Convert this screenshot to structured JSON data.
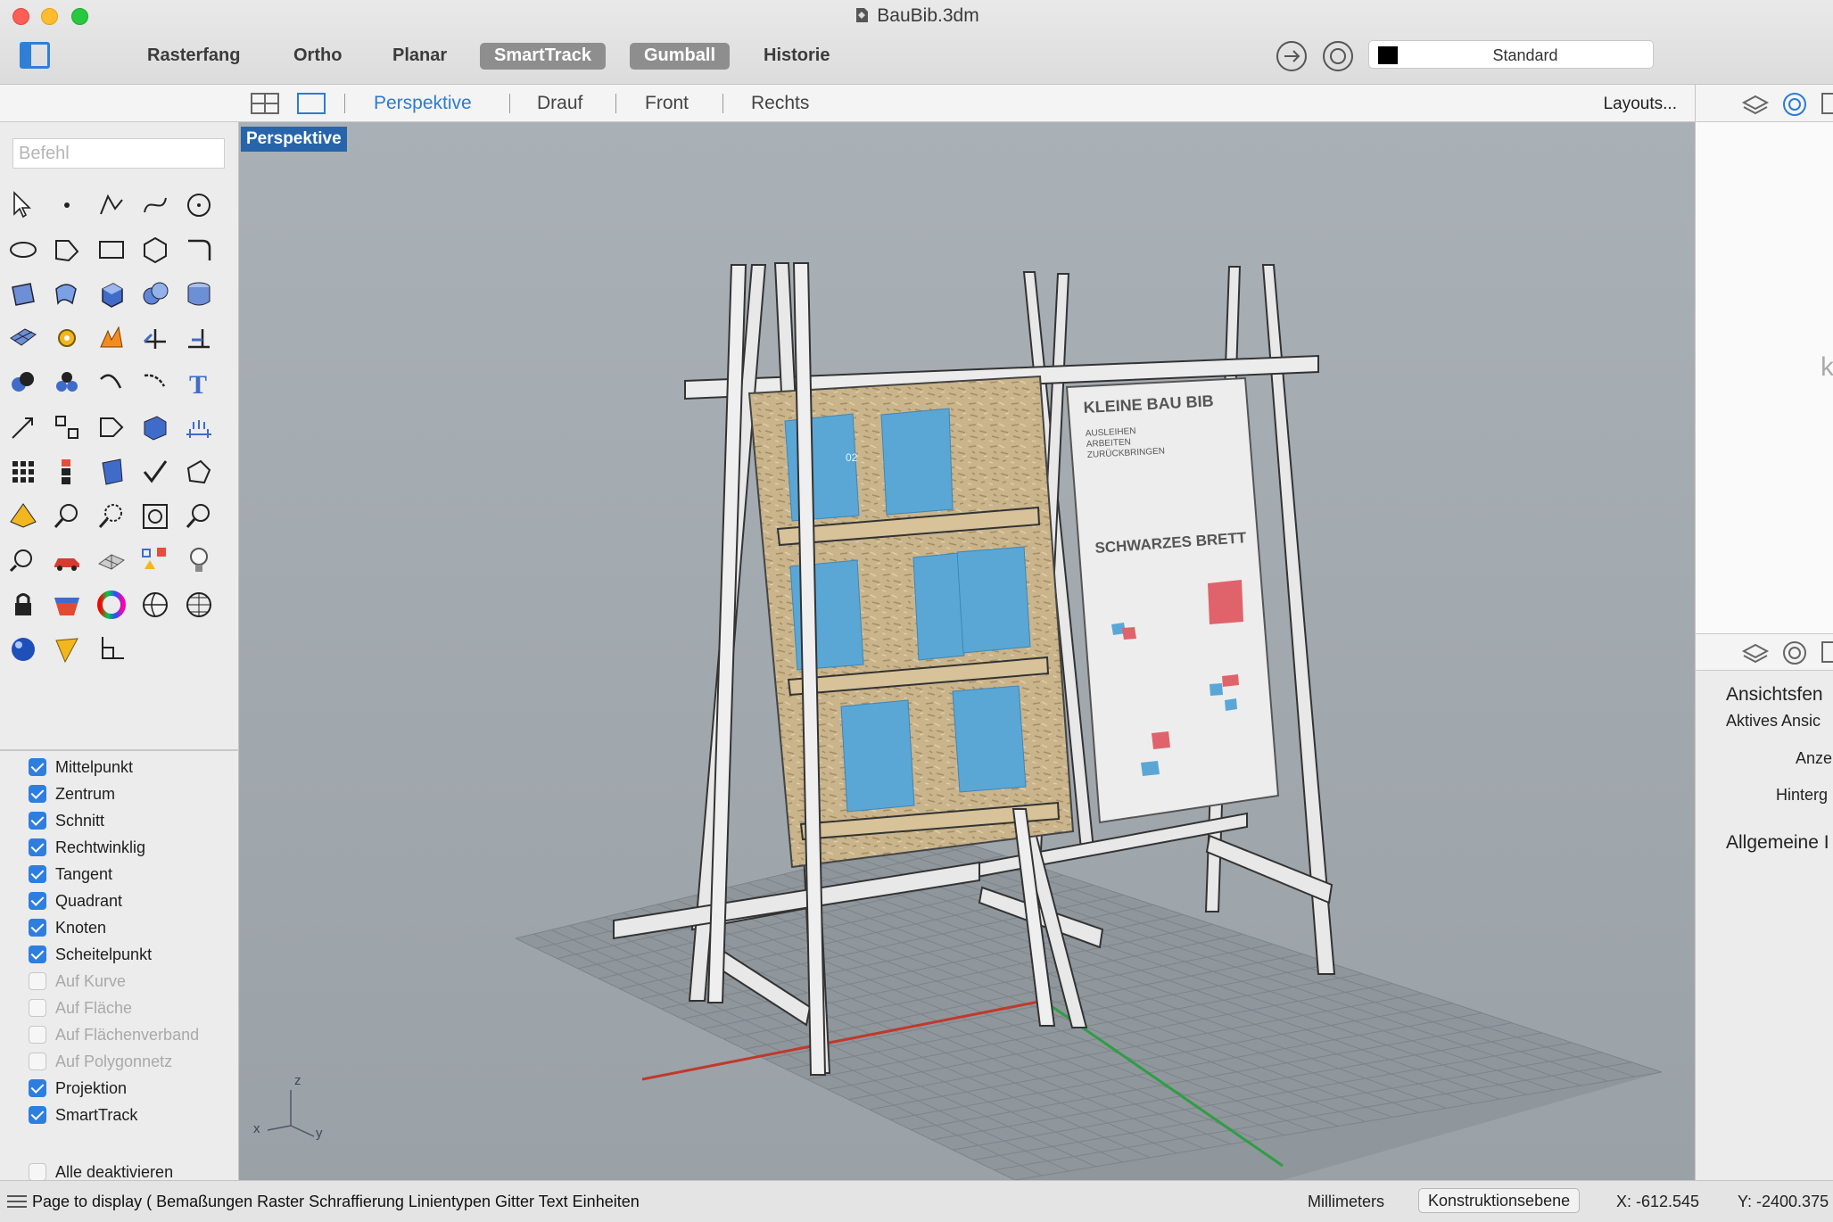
{
  "window": {
    "title": "BauBib.3dm"
  },
  "toolbar": {
    "osnap_buttons": [
      {
        "label": "Rasterfang",
        "active": false
      },
      {
        "label": "Ortho",
        "active": false
      },
      {
        "label": "Planar",
        "active": false
      },
      {
        "label": "SmartTrack",
        "active": true
      },
      {
        "label": "Gumball",
        "active": true
      },
      {
        "label": "Historie",
        "active": false
      }
    ],
    "layer": {
      "name": "Standard",
      "swatch_color": "#000000"
    }
  },
  "viewport_tabs": {
    "tabs": [
      "Perspektive",
      "Drauf",
      "Front",
      "Rechts"
    ],
    "active": "Perspektive",
    "layouts_label": "Layouts..."
  },
  "command": {
    "placeholder": "Befehl"
  },
  "tool_icons": [
    "select-arrow-icon",
    "point-icon",
    "polyline-icon",
    "curve-icon",
    "circle-icon",
    "ellipse-icon",
    "arc-icon",
    "rectangle-icon",
    "polygon-icon",
    "fillet-curve-icon",
    "surface-icon",
    "sweep-surface-icon",
    "box-solid-icon",
    "sphere-union-icon",
    "cylinder-icon",
    "mesh-plane-icon",
    "gear-icon",
    "explode-icon",
    "trim-icon",
    "split-icon",
    "boolean-icon",
    "group-icon",
    "curve-edit-icon",
    "fillet-edges-icon",
    "text-icon",
    "move-icon",
    "array-icon",
    "flow-icon",
    "extrude-icon",
    "dimension-icon",
    "grid-array-icon",
    "align-icon",
    "project-icon",
    "check-icon",
    "analyze-icon",
    "render-icon",
    "zoom-in-icon",
    "zoom-window-icon",
    "zoom-extents-icon",
    "zoom-icon",
    "rotate-view-icon",
    "car-icon",
    "grid-plane-icon",
    "named-views-icon",
    "light-bulb-icon",
    "lock-icon",
    "material-icon",
    "color-wheel-icon",
    "sphere-shade-icon",
    "wire-sphere-icon",
    "render-sphere-icon",
    "cone-light-icon",
    "cplane-icon"
  ],
  "object_snaps": [
    {
      "label": "Mittelpunkt",
      "checked": true
    },
    {
      "label": "Zentrum",
      "checked": true
    },
    {
      "label": "Schnitt",
      "checked": true
    },
    {
      "label": "Rechtwinklig",
      "checked": true
    },
    {
      "label": "Tangent",
      "checked": true
    },
    {
      "label": "Quadrant",
      "checked": true
    },
    {
      "label": "Knoten",
      "checked": true
    },
    {
      "label": "Scheitelpunkt",
      "checked": true
    },
    {
      "label": "Auf Kurve",
      "checked": false
    },
    {
      "label": "Auf Fläche",
      "checked": false
    },
    {
      "label": "Auf Flächenverband",
      "checked": false
    },
    {
      "label": "Auf Polygonnetz",
      "checked": false
    },
    {
      "label": "Projektion",
      "checked": true
    },
    {
      "label": "SmartTrack",
      "checked": true
    }
  ],
  "disable_all": {
    "label": "Alle deaktivieren",
    "checked": false
  },
  "viewport": {
    "label": "Perspektive",
    "axis_labels": {
      "x": "x",
      "y": "y",
      "z": "z"
    },
    "board_left": {
      "booklet_number": "02"
    },
    "board_right": {
      "heading": "KLEINE BAU BIB",
      "lines": [
        "AUSLEIHEN",
        "ARBEITEN",
        "ZURÜCKBRINGEN"
      ],
      "subheading": "SCHWARZES BRETT"
    }
  },
  "right_panel": {
    "partial_letter": "k",
    "section_title": "Ansichtsfen",
    "active_view_label": "Aktives Ansic",
    "display_label": "Anze",
    "background_label": "Hinterg",
    "general_label": "Allgemeine I"
  },
  "status": {
    "prompt": "Page to display ( Bemaßungen Raster Schraffierung Linientypen Gitter Text Einheiten",
    "units": "Millimeters",
    "cplane": "Konstruktionsebene",
    "x": "X: -612.545",
    "y": "Y: -2400.375"
  },
  "colors": {
    "accent": "#2e7ee0",
    "viewport_bg": "#a3aab0",
    "viewport_label_bg": "#2764a9",
    "x_axis": "#c0392b",
    "y_axis": "#2e9e44",
    "booklet_blue": "#5aa7d6",
    "sticky_red": "#e0636b"
  }
}
